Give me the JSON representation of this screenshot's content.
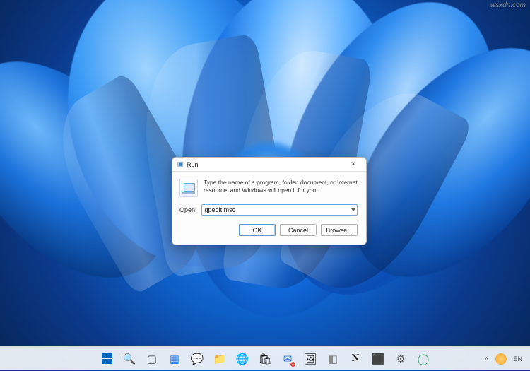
{
  "run_dialog": {
    "title": "Run",
    "description": "Type the name of a program, folder, document, or Internet resource, and Windows will open it for you.",
    "open_label": "Open:",
    "input_value": "gpedit.msc",
    "ok_label": "OK",
    "cancel_label": "Cancel",
    "browse_label": "Browse..."
  },
  "taskbar": {
    "items": [
      {
        "name": "start",
        "glyph": ""
      },
      {
        "name": "search",
        "glyph": "🔍"
      },
      {
        "name": "task-view",
        "glyph": "▢"
      },
      {
        "name": "widgets",
        "glyph": "▦"
      },
      {
        "name": "chat",
        "glyph": "💬"
      },
      {
        "name": "file-explorer",
        "glyph": "📁"
      },
      {
        "name": "edge",
        "glyph": "🌐"
      },
      {
        "name": "store",
        "glyph": "🛍"
      },
      {
        "name": "mail",
        "glyph": "✉",
        "badge": "1"
      },
      {
        "name": "photos",
        "glyph": "🖼"
      },
      {
        "name": "app-gray",
        "glyph": "◧"
      },
      {
        "name": "notion",
        "glyph": "N"
      },
      {
        "name": "app-yellow",
        "glyph": "⬛"
      },
      {
        "name": "settings",
        "glyph": "⚙"
      },
      {
        "name": "app-round",
        "glyph": "◯"
      }
    ],
    "ime": "EN"
  },
  "watermark": "wsxdn.com"
}
